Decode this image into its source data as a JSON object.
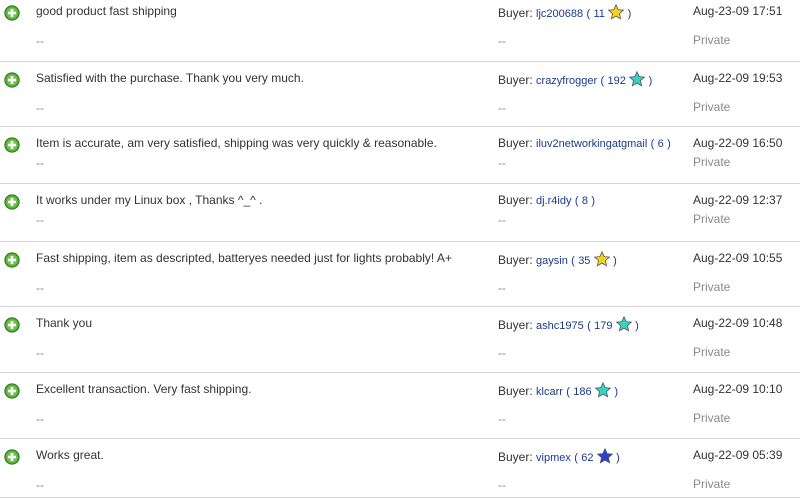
{
  "feedback": [
    {
      "comment": "good product fast shipping",
      "comment_sub": "--",
      "buyer_prefix": "Buyer:",
      "buyer": "ljc200688",
      "score": "11",
      "star": "yellow-star-icon",
      "star_color": "#f4d21f",
      "buyer_sub": "--",
      "date": "Aug-23-09 17:51",
      "privacy": "Private"
    },
    {
      "comment": "Satisfied with the purchase. Thank you very much.",
      "comment_sub": "--",
      "buyer_prefix": "Buyer:",
      "buyer": "crazyfrogger",
      "score": "192",
      "star": "turquoise-star-icon",
      "star_color": "#35d3c2",
      "buyer_sub": "--",
      "date": "Aug-22-09 19:53",
      "privacy": "Private"
    },
    {
      "comment": "Item is accurate, am very satisfied, shipping was very quickly & reasonable.",
      "comment_sub": "--",
      "buyer_prefix": "Buyer:",
      "buyer": "iluv2networkingatgmail",
      "score": "6",
      "star": "",
      "star_color": "",
      "buyer_sub": "--",
      "date": "Aug-22-09 16:50",
      "privacy": "Private"
    },
    {
      "comment": "It works under my Linux box , Thanks ^_^ .",
      "comment_sub": "--",
      "buyer_prefix": "Buyer:",
      "buyer": "dj.r4idy",
      "score": "8",
      "star": "",
      "star_color": "",
      "buyer_sub": "--",
      "date": "Aug-22-09 12:37",
      "privacy": "Private"
    },
    {
      "comment": "Fast shipping, item as descripted, batteryes needed just for lights probably! A+",
      "comment_sub": "--",
      "buyer_prefix": "Buyer:",
      "buyer": "gaysin",
      "score": "35",
      "star": "yellow-star-icon",
      "star_color": "#f4d21f",
      "buyer_sub": "--",
      "date": "Aug-22-09 10:55",
      "privacy": "Private"
    },
    {
      "comment": "Thank you",
      "comment_sub": "--",
      "buyer_prefix": "Buyer:",
      "buyer": "ashc1975",
      "score": "179",
      "star": "turquoise-star-icon",
      "star_color": "#35d3c2",
      "buyer_sub": "--",
      "date": "Aug-22-09 10:48",
      "privacy": "Private"
    },
    {
      "comment": "Excellent transaction. Very fast shipping.",
      "comment_sub": "--",
      "buyer_prefix": "Buyer:",
      "buyer": "klcarr",
      "score": "186",
      "star": "turquoise-star-icon",
      "star_color": "#35d3c2",
      "buyer_sub": "--",
      "date": "Aug-22-09 10:10",
      "privacy": "Private"
    },
    {
      "comment": "Works great.",
      "comment_sub": "--",
      "buyer_prefix": "Buyer:",
      "buyer": "vipmex",
      "score": "62",
      "star": "blue-star-icon",
      "star_color": "#2a3fd6",
      "buyer_sub": "--",
      "date": "Aug-22-09 05:39",
      "privacy": "Private"
    }
  ]
}
